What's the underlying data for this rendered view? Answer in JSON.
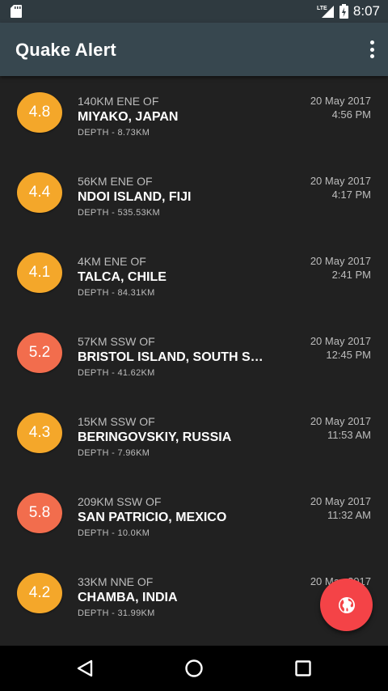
{
  "status_bar": {
    "time": "8:07",
    "network": "LTE"
  },
  "app_bar": {
    "title": "Quake Alert"
  },
  "quakes": [
    {
      "magnitude": "4.8",
      "offset": "140KM ENE OF",
      "place": "MIYAKO, JAPAN",
      "depth": "DEPTH - 8.73KM",
      "date": "20 May 2017",
      "time": "4:56 PM",
      "color": "#f4a72a"
    },
    {
      "magnitude": "4.4",
      "offset": "56KM ENE OF",
      "place": "NDOI ISLAND, FIJI",
      "depth": "DEPTH - 535.53KM",
      "date": "20 May 2017",
      "time": "4:17 PM",
      "color": "#f4a72a"
    },
    {
      "magnitude": "4.1",
      "offset": "4KM ENE OF",
      "place": "TALCA, CHILE",
      "depth": "DEPTH - 84.31KM",
      "date": "20 May 2017",
      "time": "2:41 PM",
      "color": "#f4a72a"
    },
    {
      "magnitude": "5.2",
      "offset": "57KM SSW OF",
      "place": "BRISTOL ISLAND, SOUTH SAN...",
      "depth": "DEPTH - 41.62KM",
      "date": "20 May 2017",
      "time": "12:45 PM",
      "color": "#f26d4d"
    },
    {
      "magnitude": "4.3",
      "offset": "15KM SSW OF",
      "place": "BERINGOVSKIY, RUSSIA",
      "depth": "DEPTH - 7.96KM",
      "date": "20 May 2017",
      "time": "11:53 AM",
      "color": "#f4a72a"
    },
    {
      "magnitude": "5.8",
      "offset": "209KM SSW OF",
      "place": "SAN PATRICIO, MEXICO",
      "depth": "DEPTH - 10.0KM",
      "date": "20 May 2017",
      "time": "11:32 AM",
      "color": "#f26d4d"
    },
    {
      "magnitude": "4.2",
      "offset": "33KM NNE OF",
      "place": "CHAMBA, INDIA",
      "depth": "DEPTH - 31.99KM",
      "date": "20 May 2017",
      "time": "",
      "color": "#f4a72a"
    }
  ],
  "fab": {
    "icon": "globe-icon",
    "color": "#f44347"
  },
  "nav": {
    "back_icon": "back-icon",
    "home_icon": "home-icon",
    "recents_icon": "recents-icon"
  }
}
